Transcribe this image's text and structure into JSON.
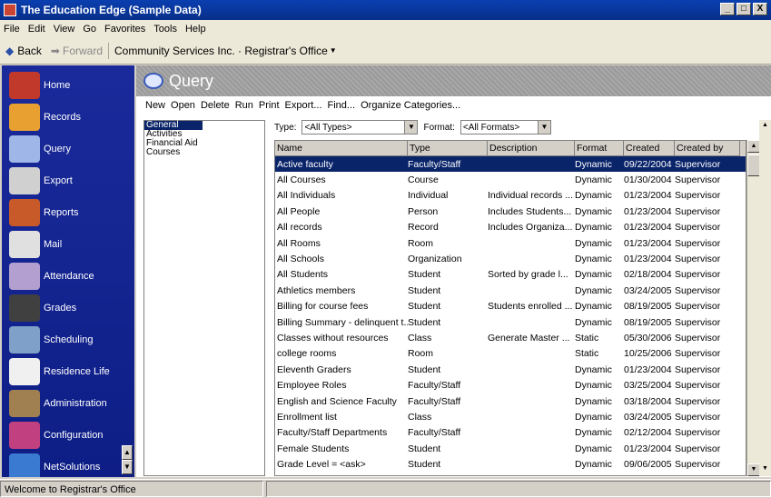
{
  "window": {
    "title": "The Education Edge (Sample Data)",
    "buttons": [
      "_",
      "□",
      "X"
    ]
  },
  "menu": [
    "File",
    "Edit",
    "View",
    "Go",
    "Favorites",
    "Tools",
    "Help"
  ],
  "nav": {
    "back": "Back",
    "forward": "Forward",
    "location": "Community Services Inc. · Registrar's Office"
  },
  "sidebar": {
    "items": [
      {
        "label": "Home",
        "icon": "home-icon",
        "color": "#c0392b"
      },
      {
        "label": "Records",
        "icon": "folders-icon",
        "color": "#e8a030"
      },
      {
        "label": "Query",
        "icon": "query-icon",
        "color": "#9fb7e8"
      },
      {
        "label": "Export",
        "icon": "export-icon",
        "color": "#d0d0d0"
      },
      {
        "label": "Reports",
        "icon": "reports-icon",
        "color": "#c85a2a"
      },
      {
        "label": "Mail",
        "icon": "mail-icon",
        "color": "#e0e0e0"
      },
      {
        "label": "Attendance",
        "icon": "attendance-icon",
        "color": "#b3a0d0"
      },
      {
        "label": "Grades",
        "icon": "grades-icon",
        "color": "#404040"
      },
      {
        "label": "Scheduling",
        "icon": "scheduling-icon",
        "color": "#7fa0c8"
      },
      {
        "label": "Residence Life",
        "icon": "residence-icon",
        "color": "#f0f0f0"
      },
      {
        "label": "Administration",
        "icon": "administration-icon",
        "color": "#a08050"
      },
      {
        "label": "Configuration",
        "icon": "configuration-icon",
        "color": "#c04080"
      },
      {
        "label": "NetSolutions",
        "icon": "netsolutions-icon",
        "color": "#3a7ad0"
      }
    ]
  },
  "query": {
    "title": "Query",
    "toolbar": [
      "New",
      "Open",
      "Delete",
      "Run",
      "Print",
      "Export...",
      "Find...",
      "Organize Categories..."
    ],
    "categories": [
      "General",
      "Activities",
      "Financial Aid",
      "Courses"
    ],
    "filters": {
      "type_label": "Type:",
      "type_value": "<All Types>",
      "format_label": "Format:",
      "format_value": "<All Formats>"
    },
    "columns": [
      "Name",
      "Type",
      "Description",
      "Format",
      "Created",
      "Created by"
    ],
    "rows": [
      [
        "Active faculty",
        "Faculty/Staff",
        "",
        "Dynamic",
        "09/22/2004",
        "Supervisor"
      ],
      [
        "All Courses",
        "Course",
        "",
        "Dynamic",
        "01/30/2004",
        "Supervisor"
      ],
      [
        "All Individuals",
        "Individual",
        "Individual records ...",
        "Dynamic",
        "01/23/2004",
        "Supervisor"
      ],
      [
        "All People",
        "Person",
        "Includes Students...",
        "Dynamic",
        "01/23/2004",
        "Supervisor"
      ],
      [
        "All records",
        "Record",
        "Includes Organiza...",
        "Dynamic",
        "01/23/2004",
        "Supervisor"
      ],
      [
        "All Rooms",
        "Room",
        "",
        "Dynamic",
        "01/23/2004",
        "Supervisor"
      ],
      [
        "All Schools",
        "Organization",
        "",
        "Dynamic",
        "01/23/2004",
        "Supervisor"
      ],
      [
        "All Students",
        "Student",
        "Sorted by grade l...",
        "Dynamic",
        "02/18/2004",
        "Supervisor"
      ],
      [
        "Athletics members",
        "Student",
        "",
        "Dynamic",
        "03/24/2005",
        "Supervisor"
      ],
      [
        "Billing for course fees",
        "Student",
        "Students enrolled ...",
        "Dynamic",
        "08/19/2005",
        "Supervisor"
      ],
      [
        "Billing Summary - delinquent t...",
        "Student",
        "",
        "Dynamic",
        "08/19/2005",
        "Supervisor"
      ],
      [
        "Classes without resources",
        "Class",
        "Generate Master ...",
        "Static",
        "05/30/2006",
        "Supervisor"
      ],
      [
        "college rooms",
        "Room",
        "",
        "Static",
        "10/25/2006",
        "Supervisor"
      ],
      [
        "Eleventh Graders",
        "Student",
        "",
        "Dynamic",
        "01/23/2004",
        "Supervisor"
      ],
      [
        "Employee Roles",
        "Faculty/Staff",
        "",
        "Dynamic",
        "03/25/2004",
        "Supervisor"
      ],
      [
        "English and Science Faculty",
        "Faculty/Staff",
        "",
        "Dynamic",
        "03/18/2004",
        "Supervisor"
      ],
      [
        "Enrollment list",
        "Class",
        "",
        "Dynamic",
        "03/24/2005",
        "Supervisor"
      ],
      [
        "Faculty/Staff Departments",
        "Faculty/Staff",
        "",
        "Dynamic",
        "02/12/2004",
        "Supervisor"
      ],
      [
        "Female Students",
        "Student",
        "",
        "Dynamic",
        "01/23/2004",
        "Supervisor"
      ],
      [
        "Grade Level = <ask>",
        "Student",
        "",
        "Dynamic",
        "09/06/2005",
        "Supervisor"
      ]
    ]
  },
  "status": {
    "text": "Welcome to Registrar's Office"
  }
}
